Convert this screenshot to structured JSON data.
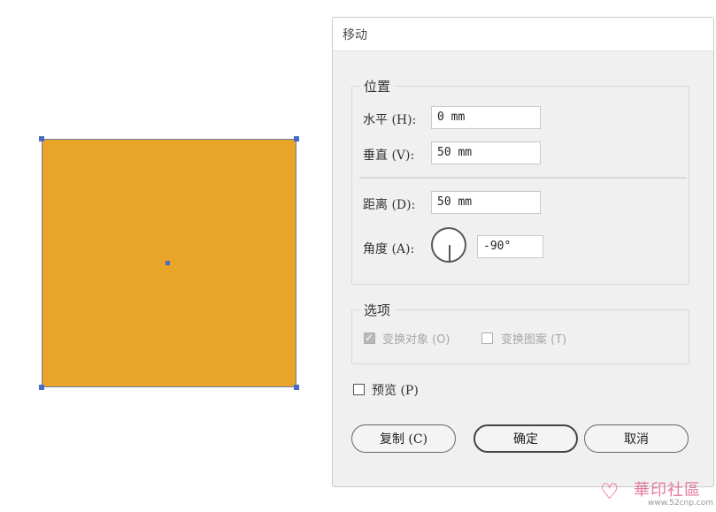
{
  "canvas": {
    "object_fill": "#e8a528",
    "selection_color": "#4a6bc4"
  },
  "dialog": {
    "title": "移动",
    "position_group": {
      "legend": "位置",
      "horizontal_label": "水平 (H):",
      "horizontal_value": "0 mm",
      "vertical_label": "垂直 (V):",
      "vertical_value": "50 mm",
      "distance_label": "距离 (D):",
      "distance_value": "50 mm",
      "angle_label": "角度 (A):",
      "angle_value": "-90°"
    },
    "options_group": {
      "legend": "选项",
      "transform_objects_label": "变换对象 (O)",
      "transform_objects_checked": true,
      "transform_patterns_label": "变换图案 (T)",
      "transform_patterns_checked": false
    },
    "preview_label": "预览 (P)",
    "preview_checked": false,
    "buttons": {
      "copy": "复制 (C)",
      "ok": "确定",
      "cancel": "取消"
    }
  },
  "watermark": {
    "logo_icon": "heart-logo-icon",
    "text": "華印社區",
    "url": "www.52cnp.com"
  }
}
